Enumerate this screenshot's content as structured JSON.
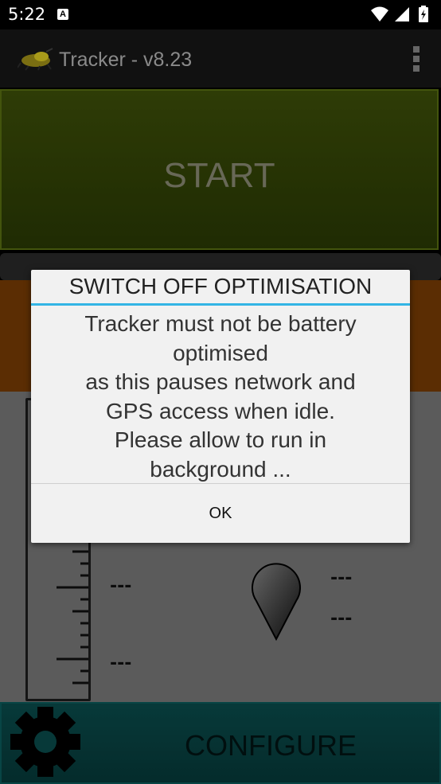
{
  "status_bar": {
    "time": "5:22",
    "notification_icon": "A"
  },
  "app_bar": {
    "title": "Tracker - v8.23"
  },
  "buttons": {
    "start": "START",
    "configure": "CONFIGURE"
  },
  "readouts": {
    "left_top": "---",
    "left_bottom": "---",
    "right_top": "---",
    "right_bottom": "---"
  },
  "dialog": {
    "title": "SWITCH OFF OPTIMISATION",
    "message_lines": [
      "Tracker must not be battery",
      "optimised",
      "as this pauses network and",
      "GPS access when idle.",
      "Please allow to run in",
      "background ..."
    ],
    "ok_label": "OK"
  },
  "colors": {
    "accent": "#33b5e5",
    "start_bg": "#3e5008",
    "configure_bg": "#0a4d4d",
    "orange_panel": "#7a3c05"
  }
}
